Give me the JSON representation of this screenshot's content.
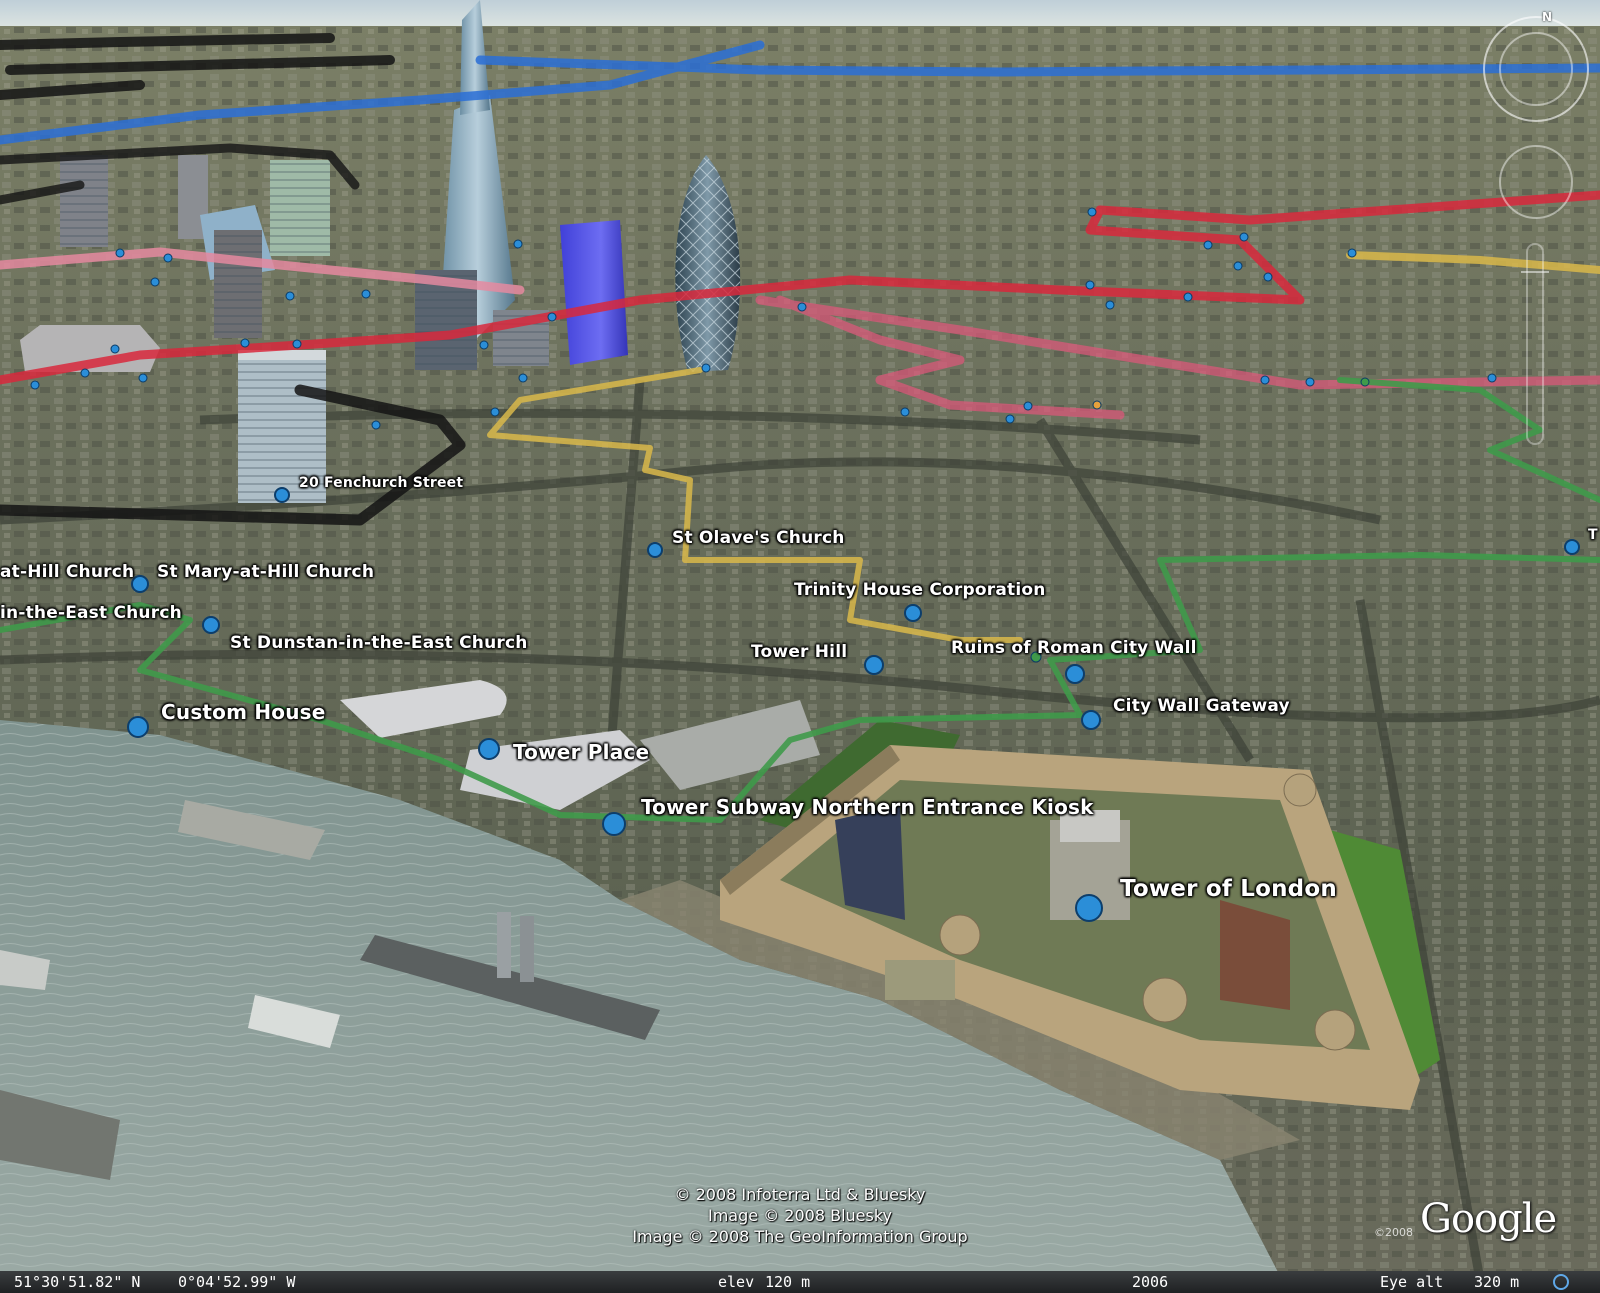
{
  "scene": {
    "sky_color": "#c9d6dc",
    "ground_color": "#6e7560",
    "river_color": "#8b9c96"
  },
  "labels": {
    "fenchurch": "20 Fenchurch Street",
    "st_olaves": "St Olave's Church",
    "st_mary_left": "at-Hill Church",
    "st_mary": "St Mary-at-Hill Church",
    "dunstan_left": "in-the-East Church",
    "st_dunstan": "St Dunstan-in-the-East Church",
    "trinity_house": "Trinity House Corporation",
    "tower_hill": "Tower Hill",
    "roman_wall": "Ruins of Roman City Wall",
    "city_wall_gateway": "City Wall Gateway",
    "custom_house": "Custom House",
    "tower_place": "Tower Place",
    "tower_subway": "Tower Subway Northern Entrance Kiosk",
    "tower_of_london": "Tower of London",
    "edge_right": "T"
  },
  "copyright": {
    "line1": "© 2008 Infoterra Ltd & Bluesky",
    "line2": "Image © 2008 Bluesky",
    "line3": "Image © 2008 The GeoInformation Group"
  },
  "logo": {
    "text": "Google",
    "year": "©2008"
  },
  "compass": {
    "north": "N"
  },
  "status": {
    "latitude": "51°30'51.82\" N",
    "longitude": "0°04'52.99\" W",
    "elev_label": "elev",
    "elev_value": "120 m",
    "year": "2006",
    "eye_alt_label": "Eye alt",
    "eye_alt_value": "320 m"
  },
  "tour_colors": {
    "blue": "#2a6fd6",
    "red": "#d8283c",
    "pink": "#e58aa0",
    "yellow": "#d9b84a",
    "green": "#3f9a4a",
    "black": "#141414",
    "placemark": "#2b8ed8"
  }
}
